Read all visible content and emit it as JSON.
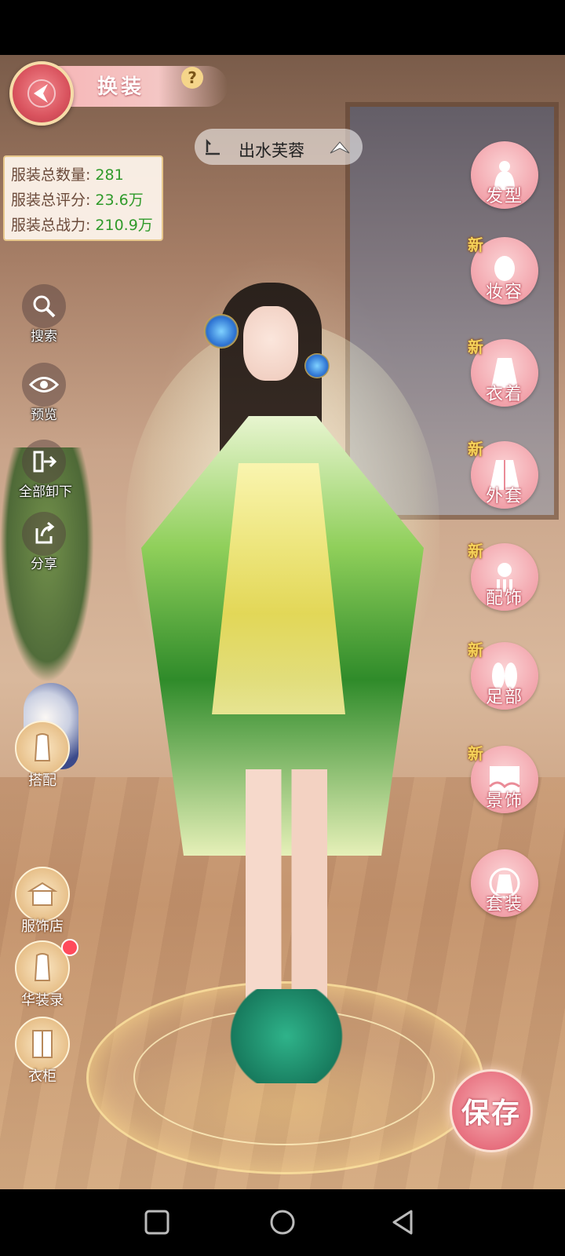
{
  "header": {
    "title": "换装",
    "help_glyph": "?"
  },
  "outfit": {
    "name": "出水芙蓉"
  },
  "stats": [
    {
      "label": "服装总数量:",
      "value": "281"
    },
    {
      "label": "服装总评分:",
      "value": "23.6万"
    },
    {
      "label": "服装总战力:",
      "value": "210.9万"
    }
  ],
  "left_tools": [
    {
      "label": "搜索",
      "icon": "search-icon"
    },
    {
      "label": "预览",
      "icon": "eye-icon"
    },
    {
      "label": "全部卸下",
      "icon": "undress-all-icon"
    },
    {
      "label": "分享",
      "icon": "share-icon"
    }
  ],
  "left_menu": [
    {
      "label": "搭配",
      "icon": "outfit-match-icon"
    },
    {
      "label": "服饰店",
      "icon": "shop-icon"
    },
    {
      "label": "华装录",
      "icon": "collection-icon"
    },
    {
      "label": "衣柜",
      "icon": "wardrobe-icon"
    }
  ],
  "categories": [
    {
      "label": "发型",
      "new": "",
      "icon": "hairstyle-icon"
    },
    {
      "label": "妆容",
      "new": "新",
      "icon": "makeup-icon"
    },
    {
      "label": "衣着",
      "new": "新",
      "icon": "clothing-icon"
    },
    {
      "label": "外套",
      "new": "新",
      "icon": "coat-icon"
    },
    {
      "label": "配饰",
      "new": "新",
      "icon": "accessory-icon"
    },
    {
      "label": "足部",
      "new": "新",
      "icon": "shoes-icon"
    },
    {
      "label": "景饰",
      "new": "新",
      "icon": "scenery-icon"
    },
    {
      "label": "套装",
      "new": "",
      "icon": "suit-icon"
    }
  ],
  "save": {
    "label": "保存"
  },
  "colors": {
    "accent_pink": "#e7707f",
    "stat_value_green": "#2f9a2a",
    "new_badge": "#f6d35a"
  }
}
